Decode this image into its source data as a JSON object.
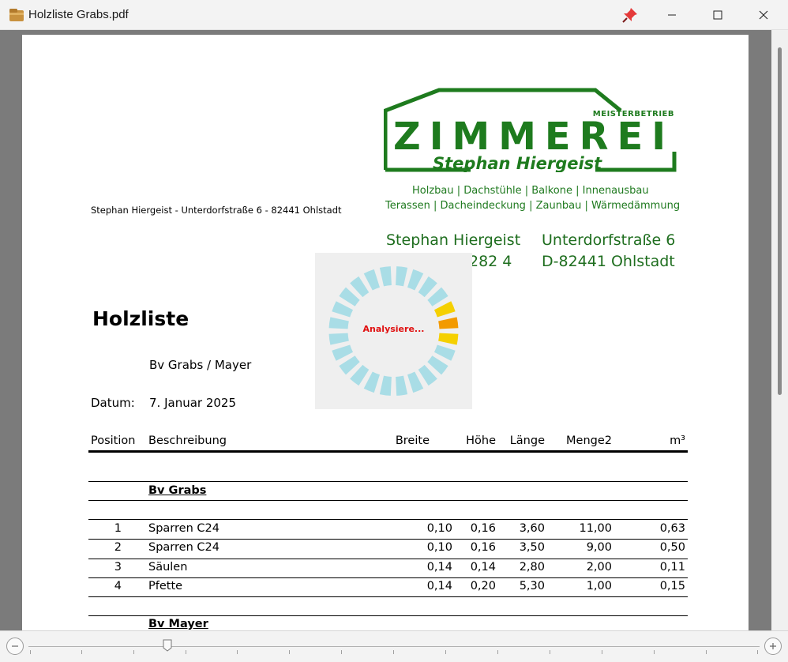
{
  "window": {
    "title": "Holzliste Grabs.pdf"
  },
  "logo": {
    "small": "MEISTERBETRIEB",
    "big": "ZIMMEREI",
    "name": "Stephan Hiergeist",
    "color": "#1e7b1e"
  },
  "services": {
    "line1": "Holzbau | Dachstühle  | Balkone | Innenausbau",
    "line2": "Terassen | Dacheindeckung | Zaunbau | Wärmedämmung"
  },
  "sender_line": "Stephan Hiergeist  - Unterdorfstraße 6  -  82441 Ohlstadt",
  "address": {
    "name": "Stephan Hiergeist",
    "phone_partial": "282 4",
    "street": "Unterdorfstraße 6",
    "city": "D-82441 Ohlstadt"
  },
  "document": {
    "title": "Holzliste",
    "project": "Bv Grabs / Mayer",
    "date_label": "Datum:",
    "date_value": "7. Januar 2025"
  },
  "table": {
    "headers": {
      "position": "Position",
      "beschreibung": "Beschreibung",
      "breite": "Breite",
      "hoehe": "Höhe",
      "laenge": "Länge",
      "menge": "Menge2",
      "m3": "m³"
    },
    "sections": [
      {
        "title": "Bv Grabs ",
        "rows": [
          {
            "pos": "1",
            "desc": "Sparren C24",
            "breite": "0,10",
            "hoehe": "0,16",
            "laenge": "3,60",
            "menge": "11,00",
            "m3": "0,63"
          },
          {
            "pos": "2",
            "desc": "Sparren C24",
            "breite": "0,10",
            "hoehe": "0,16",
            "laenge": "3,50",
            "menge": "9,00",
            "m3": "0,50"
          },
          {
            "pos": "3",
            "desc": "Säulen",
            "breite": "0,14",
            "hoehe": "0,14",
            "laenge": "2,80",
            "menge": "2,00",
            "m3": "0,11"
          },
          {
            "pos": "4",
            "desc": "Pfette",
            "breite": "0,14",
            "hoehe": "0,20",
            "laenge": "5,30",
            "menge": "1,00",
            "m3": "0,15"
          }
        ]
      },
      {
        "title": "Bv Mayer",
        "rows": []
      }
    ]
  },
  "overlay": {
    "label": "Analysiere...",
    "segment_count": 24,
    "active_segments": [
      4,
      5,
      6
    ],
    "colors": {
      "idle": "#a9dde6",
      "active": "#f5d000",
      "current": "#f39a00"
    }
  },
  "zoom": {
    "level_fraction": 0.19
  }
}
